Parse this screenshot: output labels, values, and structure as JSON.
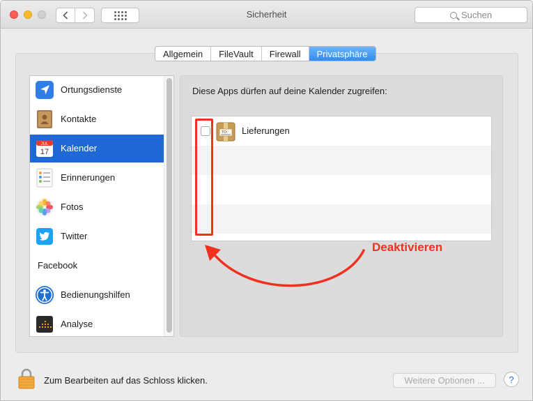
{
  "window": {
    "title": "Sicherheit",
    "search_placeholder": "Suchen"
  },
  "toolbar": {
    "back_icon": "chevron-left-icon",
    "forward_icon": "chevron-right-icon",
    "grid_icon": "show-all-grid-icon"
  },
  "tabs": [
    {
      "label": "Allgemein",
      "active": false
    },
    {
      "label": "FileVault",
      "active": false
    },
    {
      "label": "Firewall",
      "active": false
    },
    {
      "label": "Privatsphäre",
      "active": true
    }
  ],
  "sidebar": {
    "items": [
      {
        "label": "Ortungsdienste",
        "icon": "location-arrow-icon",
        "selected": false
      },
      {
        "label": "Kontakte",
        "icon": "contacts-book-icon",
        "selected": false
      },
      {
        "label": "Kalender",
        "icon": "calendar-icon",
        "icon_text_month": "JUL",
        "icon_text_day": "17",
        "selected": true
      },
      {
        "label": "Erinnerungen",
        "icon": "reminders-list-icon",
        "selected": false
      },
      {
        "label": "Fotos",
        "icon": "photos-flower-icon",
        "selected": false
      },
      {
        "label": "Twitter",
        "icon": "twitter-bird-icon",
        "selected": false
      },
      {
        "label": "Facebook",
        "icon": null,
        "selected": false
      },
      {
        "label": "Bedienungshilfen",
        "icon": "accessibility-icon",
        "selected": false
      },
      {
        "label": "Analyse",
        "icon": "analytics-icon",
        "selected": false
      }
    ]
  },
  "calendar_panel": {
    "heading": "Diese Apps dürfen auf deine Kalender zugreifen:",
    "apps": [
      {
        "name": "Lieferungen",
        "checked": false,
        "icon": "deliveries-package-icon",
        "icon_text": "TO:"
      }
    ]
  },
  "annotation": {
    "label": "Deaktivieren",
    "color": "#f0311f"
  },
  "footer": {
    "lock_text": "Zum Bearbeiten auf das Schloss klicken.",
    "more_options_label": "Weitere Optionen ...",
    "help_label": "?"
  },
  "colors": {
    "selection": "#1f69d6",
    "tab_active": "#2e8ef6"
  }
}
